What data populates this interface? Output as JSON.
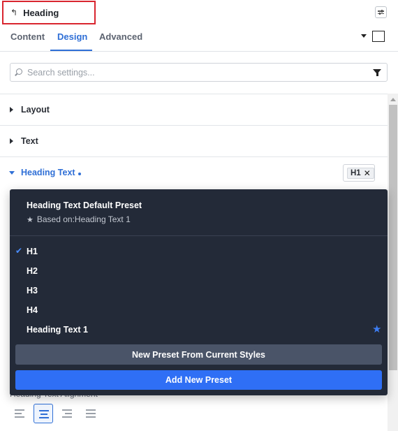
{
  "header": {
    "title": "Heading",
    "back_icon": "↰",
    "options_icon": "sliders-icon"
  },
  "tabs": [
    {
      "label": "Content",
      "active": false
    },
    {
      "label": "Design",
      "active": true
    },
    {
      "label": "Advanced",
      "active": false
    }
  ],
  "search": {
    "placeholder": "Search settings...",
    "value": ""
  },
  "sections": {
    "layout": "Layout",
    "text": "Text",
    "heading_text": "Heading Text",
    "heading_text_preset_chip": "H1",
    "chip_close": "✕"
  },
  "dropdown": {
    "title": "Heading Text Default Preset",
    "based_on": "Based on:Heading Text 1",
    "items": [
      {
        "label": "H1",
        "selected": true
      },
      {
        "label": "H2",
        "selected": false
      },
      {
        "label": "H3",
        "selected": false
      },
      {
        "label": "H4",
        "selected": false
      },
      {
        "label": "Heading Text 1",
        "selected": false,
        "default": true
      }
    ],
    "check": "✔",
    "star": "★",
    "new_preset_button": "New Preset From Current Styles",
    "add_preset_button": "Add New Preset"
  },
  "alignment": {
    "label": "Heading Text Alignment",
    "options": [
      "left",
      "center",
      "right",
      "justify"
    ],
    "selected": "center"
  },
  "colors": {
    "accent": "#2f6fd6",
    "dropdown_bg": "#232a38",
    "add_button": "#2f6ff5",
    "highlight_border": "#d9252f"
  }
}
